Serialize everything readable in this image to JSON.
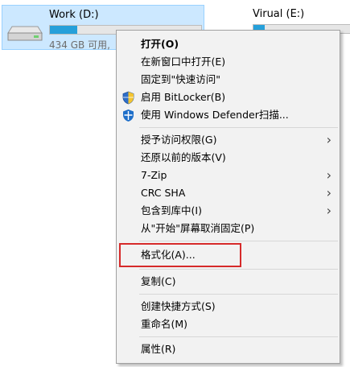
{
  "drives": [
    {
      "name": "Work (D:)",
      "free_text": "434 GB 可用,",
      "usage_fraction": 0.18,
      "selected": true
    },
    {
      "name": "Virual (E:)",
      "usage_fraction": 0.12,
      "selected": false
    }
  ],
  "menu": {
    "open": "打开(O)",
    "open_new_window": "在新窗口中打开(E)",
    "pin_quick_access": "固定到\"快速访问\"",
    "bitlocker": "启用 BitLocker(B)",
    "defender": "使用 Windows Defender扫描...",
    "grant_access": "授予访问权限(G)",
    "restore_versions": "还原以前的版本(V)",
    "zip": "7-Zip",
    "crc": "CRC SHA",
    "include_library": "包含到库中(I)",
    "unpin_start": "从\"开始\"屏幕取消固定(P)",
    "format": "格式化(A)...",
    "copy": "复制(C)",
    "create_shortcut": "创建快捷方式(S)",
    "rename": "重命名(M)",
    "properties": "属性(R)"
  },
  "colors": {
    "highlight_box": "#d62a2a",
    "selected_tile": "#cce8ff",
    "usage_fill": "#26a0da"
  },
  "icons": {
    "bitlocker": "shield-icon",
    "defender": "defender-icon",
    "submenu": "chevron-right-icon",
    "drive": "hard-drive-icon"
  }
}
